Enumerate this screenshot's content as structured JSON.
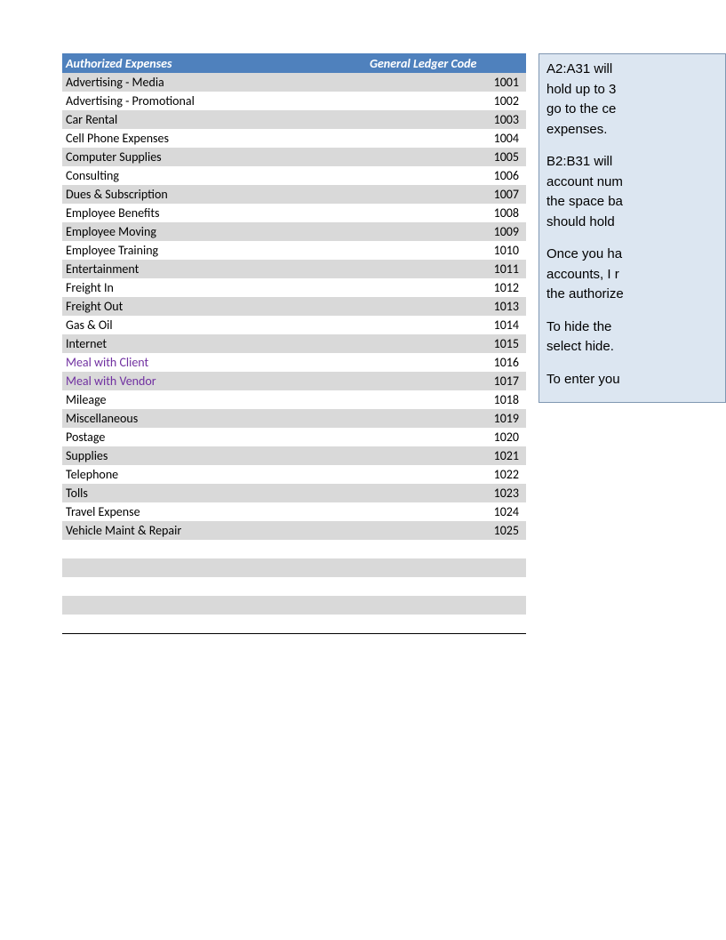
{
  "table": {
    "headers": {
      "expense": "Authorized Expenses",
      "code": "General Ledger Code"
    },
    "rows": [
      {
        "expense": "Advertising - Media",
        "code": "1001",
        "purple": false
      },
      {
        "expense": "Advertising - Promotional",
        "code": "1002",
        "purple": false
      },
      {
        "expense": "Car Rental",
        "code": "1003",
        "purple": false
      },
      {
        "expense": "Cell Phone Expenses",
        "code": "1004",
        "purple": false
      },
      {
        "expense": "Computer Supplies",
        "code": "1005",
        "purple": false
      },
      {
        "expense": "Consulting",
        "code": "1006",
        "purple": false
      },
      {
        "expense": "Dues & Subscription",
        "code": "1007",
        "purple": false
      },
      {
        "expense": "Employee Benefits",
        "code": "1008",
        "purple": false
      },
      {
        "expense": "Employee Moving",
        "code": "1009",
        "purple": false
      },
      {
        "expense": "Employee Training",
        "code": "1010",
        "purple": false
      },
      {
        "expense": "Entertainment",
        "code": "1011",
        "purple": false
      },
      {
        "expense": "Freight In",
        "code": "1012",
        "purple": false
      },
      {
        "expense": "Freight Out",
        "code": "1013",
        "purple": false
      },
      {
        "expense": "Gas & Oil",
        "code": "1014",
        "purple": false
      },
      {
        "expense": "Internet",
        "code": "1015",
        "purple": false
      },
      {
        "expense": "Meal with Client",
        "code": "1016",
        "purple": true
      },
      {
        "expense": "Meal with Vendor",
        "code": "1017",
        "purple": true
      },
      {
        "expense": "Mileage",
        "code": "1018",
        "purple": false
      },
      {
        "expense": "Miscellaneous",
        "code": "1019",
        "purple": false
      },
      {
        "expense": "Postage",
        "code": "1020",
        "purple": false
      },
      {
        "expense": "Supplies",
        "code": "1021",
        "purple": false
      },
      {
        "expense": "Telephone",
        "code": "1022",
        "purple": false
      },
      {
        "expense": "Tolls",
        "code": "1023",
        "purple": false
      },
      {
        "expense": "Travel Expense",
        "code": "1024",
        "purple": false
      },
      {
        "expense": "Vehicle Maint & Repair",
        "code": "1025",
        "purple": false
      }
    ]
  },
  "sidebox": {
    "p1_l1": "A2:A31 will",
    "p1_l2": "hold up to 3",
    "p1_l3": "go to the ce",
    "p1_l4": "expenses.",
    "p2_l1": "B2:B31 will",
    "p2_l2": "account num",
    "p2_l3": "the space ba",
    "p2_l4": "should hold",
    "p3_l1": "Once you ha",
    "p3_l2": "accounts, I r",
    "p3_l3": "the authorize",
    "p4_l1": "To hide the",
    "p4_l2": "select hide.",
    "p5_l1": "To enter you"
  }
}
